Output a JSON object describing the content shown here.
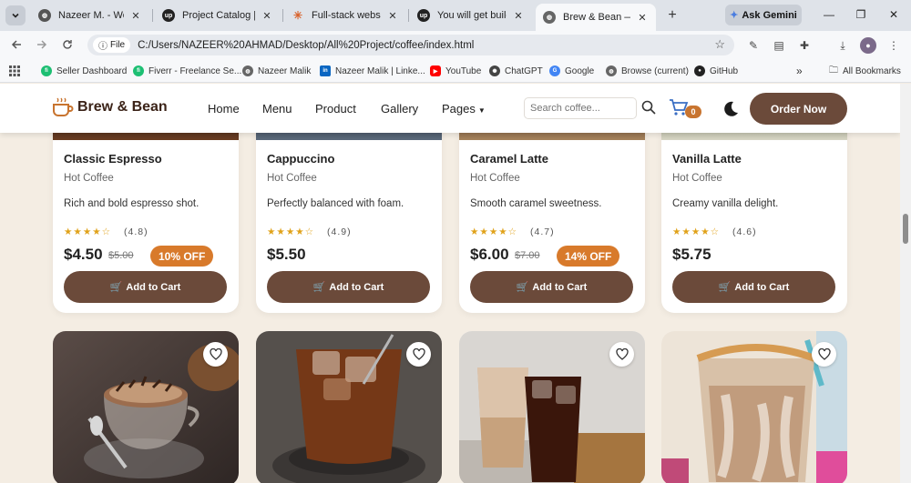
{
  "browser": {
    "tabs": [
      {
        "title": "Nazeer M. - Web De",
        "favicon": "globe-icon",
        "active": false
      },
      {
        "title": "Project Catalog | Up",
        "favicon": "upwork-icon",
        "active": false
      },
      {
        "title": "Full-stack website d",
        "favicon": "claude-icon",
        "active": false
      },
      {
        "title": "You will get building",
        "favicon": "upwork-icon",
        "active": false
      },
      {
        "title": "Brew & Bean — Pre",
        "favicon": "globe-icon",
        "active": true
      }
    ],
    "gemini_label": "Ask Gemini",
    "address": {
      "chip": "File",
      "url": "C:/Users/NAZEER%20AHMAD/Desktop/All%20Project/coffee/index.html"
    },
    "bookmarks": [
      {
        "label": "Seller Dashboard",
        "icon": "fiverr-icon"
      },
      {
        "label": "Fiverr - Freelance Se...",
        "icon": "fiverr-icon"
      },
      {
        "label": "Nazeer Malik",
        "icon": "globe-icon"
      },
      {
        "label": "Nazeer Malik | Linke...",
        "icon": "linkedin-icon"
      },
      {
        "label": "YouTube",
        "icon": "youtube-icon"
      },
      {
        "label": "ChatGPT",
        "icon": "chatgpt-icon"
      },
      {
        "label": "Google",
        "icon": "google-icon"
      },
      {
        "label": "Browse (current)",
        "icon": "globe-icon"
      },
      {
        "label": "GitHub",
        "icon": "github-icon"
      }
    ],
    "all_bookmarks": "All Bookmarks"
  },
  "site": {
    "logo": "Brew & Bean",
    "nav": [
      "Home",
      "Menu",
      "Product",
      "Gallery",
      "Pages"
    ],
    "search_placeholder": "Search coffee...",
    "cart_count": "0",
    "order_button": "Order Now",
    "colors": {
      "brown": "#6b4a3a",
      "orange": "#d87a2b",
      "cream": "#f4ede3"
    }
  },
  "products": [
    {
      "name": "Classic Espresso",
      "category": "Hot Coffee",
      "desc": "Rich and bold espresso shot.",
      "rating": "(4.8)",
      "price": "$4.50",
      "old_price": "$5.00",
      "badge": "10% OFF",
      "cart": "Add to Cart"
    },
    {
      "name": "Cappuccino",
      "category": "Hot Coffee",
      "desc": "Perfectly balanced with foam.",
      "rating": "(4.9)",
      "price": "$5.50",
      "old_price": "",
      "badge": "",
      "cart": "Add to Cart"
    },
    {
      "name": "Caramel Latte",
      "category": "Hot Coffee",
      "desc": "Smooth caramel sweetness.",
      "rating": "(4.7)",
      "price": "$6.00",
      "old_price": "$7.00",
      "badge": "14% OFF",
      "cart": "Add to Cart"
    },
    {
      "name": "Vanilla Latte",
      "category": "Hot Coffee",
      "desc": "Creamy vanilla delight.",
      "rating": "(4.6)",
      "price": "$5.75",
      "old_price": "",
      "badge": "",
      "cart": "Add to Cart"
    }
  ],
  "stars": "★★★★☆"
}
